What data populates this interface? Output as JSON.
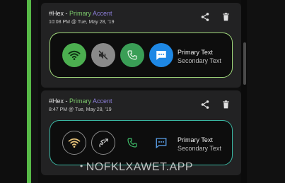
{
  "cards": [
    {
      "title": {
        "hex": "#Hex",
        "sep": " - ",
        "primary": "Primary",
        "accent": "Accent"
      },
      "timestamp": "10:08 PM @ Tue, May 28, '19",
      "preview_style": "filled",
      "preview": {
        "primary_text": "Primary Text",
        "secondary_text": "Secondary Text"
      },
      "preview_icons": [
        "wifi-icon",
        "volume-off-icon",
        "phone-icon",
        "chat-icon"
      ]
    },
    {
      "title": {
        "hex": "#Hex",
        "sep": " - ",
        "primary": "Primary",
        "accent": "Accent"
      },
      "timestamp": "8:47 PM @ Tue, May 28, '19",
      "preview_style": "outlined",
      "preview": {
        "primary_text": "Primary Text",
        "secondary_text": "Secondary Text"
      },
      "preview_icons": [
        "wifi-icon",
        "phone-missed-icon",
        "phone-icon",
        "chat-icon"
      ]
    }
  ],
  "watermark": {
    "dot": "•",
    "text": "NOFKLXAWET.APP"
  },
  "colors": {
    "primary": "#7cc96b",
    "accent": "#8c7fd9",
    "card_bg": "#222223",
    "border_1": "#9fd77a",
    "border_2": "#3ab7a3"
  }
}
